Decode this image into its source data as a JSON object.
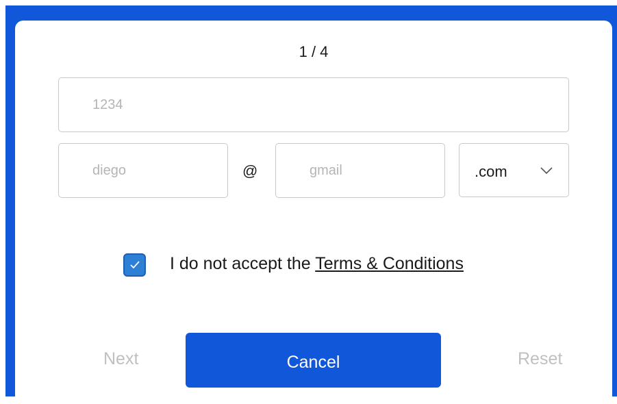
{
  "form": {
    "step_indicator": "1 / 4",
    "phone_placeholder": "1234",
    "email_user_placeholder": "diego",
    "email_at": "@",
    "email_domain_placeholder": "gmail",
    "tld_selected": ".com",
    "consent_prefix": "I do not accept the ",
    "terms_link": "Terms & Conditions",
    "checkbox_checked": true
  },
  "buttons": {
    "next": "Next",
    "cancel": "Cancel",
    "reset": "Reset"
  },
  "colors": {
    "accent": "#1157d9",
    "checkbox": "#2e7fd6",
    "muted_text": "#c0c0c0"
  },
  "icons": {
    "select_arrow": "chevron-down-icon",
    "checkbox_mark": "checkmark-icon"
  }
}
